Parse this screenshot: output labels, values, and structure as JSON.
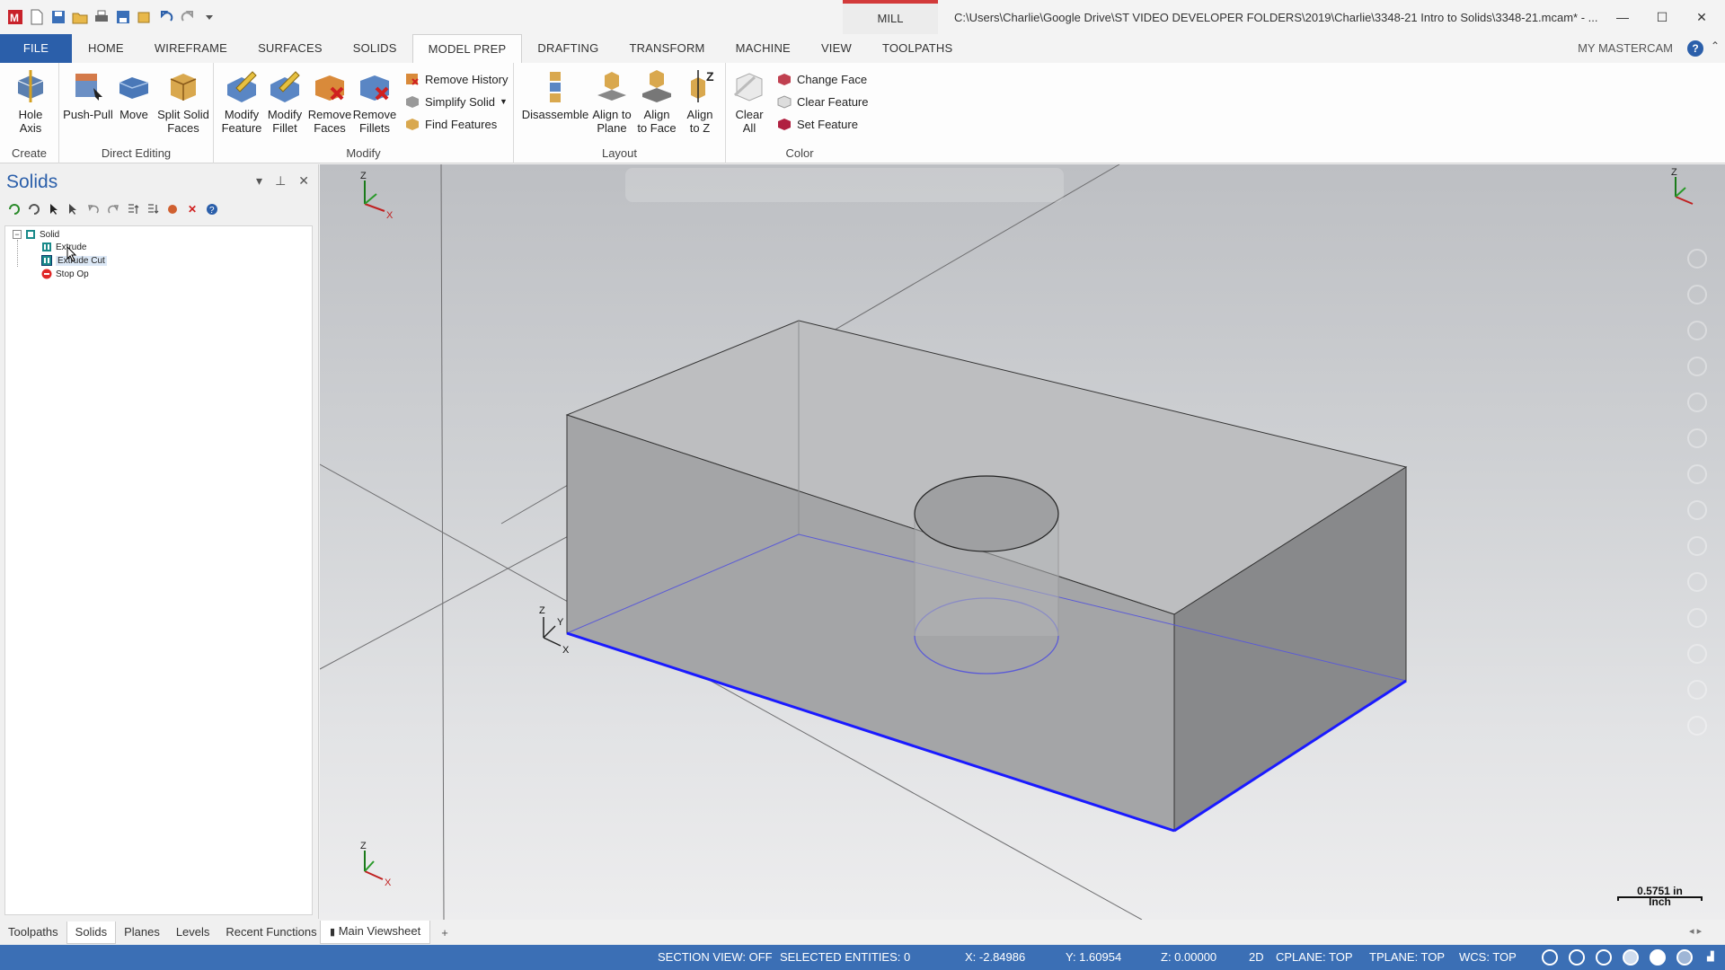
{
  "window": {
    "context_tab": "MILL",
    "title": "C:\\Users\\Charlie\\Google Drive\\ST VIDEO DEVELOPER FOLDERS\\2019\\Charlie\\3348-21 Intro to Solids\\3348-21.mcam* - ...",
    "minimize": "—",
    "maximize": "☐",
    "close": "✕"
  },
  "ribbon_tabs": [
    "FILE",
    "HOME",
    "WIREFRAME",
    "SURFACES",
    "SOLIDS",
    "MODEL PREP",
    "DRAFTING",
    "TRANSFORM",
    "MACHINE",
    "VIEW",
    "TOOLPATHS"
  ],
  "my_mastercam": "MY MASTERCAM",
  "help": "?",
  "ribbon": {
    "create": {
      "label": "Create",
      "hole_axis": "Hole\nAxis"
    },
    "direct_editing": {
      "label": "Direct Editing",
      "push_pull": "Push-Pull",
      "move": "Move",
      "split_solid_faces": "Split Solid\nFaces"
    },
    "modify": {
      "label": "Modify",
      "modify_feature": "Modify\nFeature",
      "modify_fillet": "Modify\nFillet",
      "remove_faces": "Remove\nFaces",
      "remove_fillets": "Remove\nFillets",
      "remove_history": "Remove History",
      "simplify_solid": "Simplify Solid",
      "find_features": "Find Features"
    },
    "layout": {
      "label": "Layout",
      "disassemble": "Disassemble",
      "align_to_plane": "Align to\nPlane",
      "align_to_face": "Align\nto Face",
      "align_to_z": "Align\nto Z"
    },
    "color": {
      "label": "Color",
      "clear_all": "Clear\nAll",
      "change_face": "Change Face",
      "clear_feature": "Clear Feature",
      "set_feature": "Set Feature"
    }
  },
  "solids_panel": {
    "title": "Solids",
    "tree": {
      "root": "Solid",
      "items": [
        "Extrude",
        "Extrude Cut",
        "Stop Op"
      ]
    }
  },
  "bottom_tabs": [
    "Toolpaths",
    "Solids",
    "Planes",
    "Levels",
    "Recent Functions"
  ],
  "viewsheet": {
    "tab": "Main Viewsheet",
    "add": "+"
  },
  "scale": {
    "value": "0.5751 in",
    "unit": "Inch"
  },
  "axes": {
    "x": "X",
    "y": "Y",
    "z": "Z"
  },
  "status": {
    "section_view": "SECTION VIEW: OFF",
    "selected": "SELECTED ENTITIES: 0",
    "x": "X:   -2.84986",
    "y": "Y:   1.60954",
    "z": "Z:   0.00000",
    "mode": "2D",
    "cplane": "CPLANE: TOP",
    "tplane": "TPLANE: TOP",
    "wcs": "WCS: TOP"
  },
  "colors": {
    "accent": "#2b5faa",
    "status_bar": "#3b6fb5",
    "selection_edge": "#1a1aff",
    "mill_tab": "#d23a3a"
  }
}
